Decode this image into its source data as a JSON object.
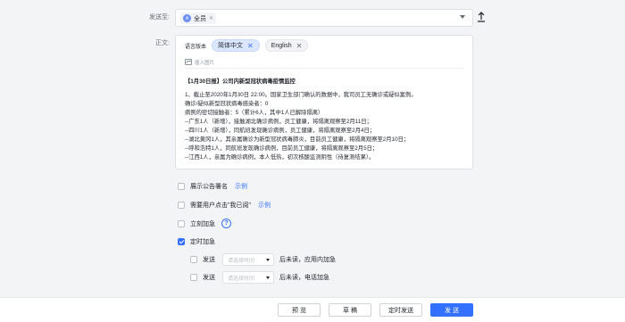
{
  "send_to": {
    "label": "发送至:",
    "recipient": "全员",
    "recipient_avatar": "A"
  },
  "body": {
    "label": "正文:",
    "language_label": "语言版本",
    "languages": [
      {
        "name": "简体中文",
        "active": true
      },
      {
        "name": "English",
        "active": false
      }
    ],
    "insert_image": "插入图片",
    "title": "【1月30日报】公司内新型冠状病毒疫情监控",
    "lines": [
      "1、截止至2020年1月30日 22:00。国家卫生部门确认的数据中，我司员工无确诊或疑似案例。",
      "确诊/疑似新型冠状病毒感染者：0",
      "病例的密切接触者：5（累计6人，其中1人已解除隔离）",
      "--广东1人（新增），接触湖北确诊病例，员工健康，将隔离观察至2月11日；",
      "--四川1人（新增），同航班发现确诊病例，员工健康，将隔离观察至2月4日；",
      "--湖北黄冈1人，其亲属确诊为新型冠状病毒肺炎，目前员工健康，将隔离观察至2月10日；",
      "--呼和浩特1人，同航班发现确诊病例，目前员工健康，将隔离观察至2月5日；",
      "--江西1人，亲属为确诊病例，本人低热，初次核酸监测阴性（待复测结果）。"
    ]
  },
  "options": {
    "show_signature": {
      "label": "展示公告署名",
      "link": "示例",
      "checked": false
    },
    "require_read": {
      "label": "需要用户点击\"我已阅\"",
      "link": "示例",
      "checked": false
    },
    "urgent_now": {
      "label": "立刻加急",
      "help": "?",
      "checked": false
    },
    "scheduled_urgent": {
      "label": "定时加急",
      "checked": true
    },
    "sub1": {
      "send_label": "发送",
      "placeholder": "请选择时间",
      "after": "后未读，应用内加急",
      "checked": false
    },
    "sub2": {
      "send_label": "发送",
      "placeholder": "请选择时间",
      "after": "后未读，电话加急",
      "checked": false
    }
  },
  "footer": {
    "preview": "预 览",
    "draft": "草 稿",
    "schedule_send": "定时发送",
    "send": "发 送"
  },
  "colors": {
    "accent": "#3370ff",
    "background": "#f3f4f6"
  },
  "icons": [
    "close-icon",
    "chevron-down-icon",
    "upload-icon",
    "image-icon",
    "help-icon"
  ]
}
